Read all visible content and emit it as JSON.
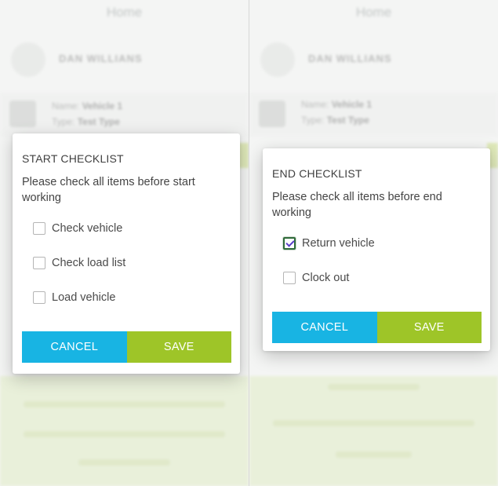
{
  "background": {
    "title": "Home",
    "user_name": "DAN WILLIANS",
    "vehicle_label": "Name:",
    "vehicle_value": "Vehicle 1",
    "type_label": "Type:",
    "type_value": "Test Type"
  },
  "start_dialog": {
    "title": "START CHECKLIST",
    "description": "Please check all items before start working",
    "items": [
      {
        "label": "Check vehicle",
        "checked": false
      },
      {
        "label": "Check load list",
        "checked": false
      },
      {
        "label": "Load vehicle",
        "checked": false
      }
    ],
    "cancel_label": "CANCEL",
    "save_label": "SAVE"
  },
  "end_dialog": {
    "title": "END CHECKLIST",
    "description": "Please check all items before end working",
    "items": [
      {
        "label": "Return vehicle",
        "checked": true
      },
      {
        "label": "Clock out",
        "checked": false
      }
    ],
    "cancel_label": "CANCEL",
    "save_label": "SAVE"
  },
  "colors": {
    "cancel": "#18b4e3",
    "save": "#9ec528",
    "check_mark": "#5b3ec8"
  }
}
